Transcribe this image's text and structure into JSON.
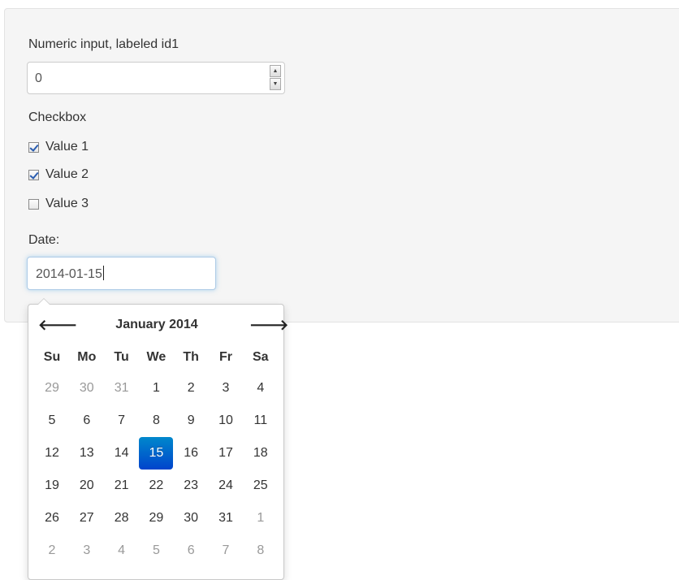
{
  "form": {
    "numeric_label": "Numeric input, labeled id1",
    "numeric_value": "0",
    "checkbox_label": "Checkbox",
    "checkboxes": [
      {
        "label": "Value 1",
        "checked": true
      },
      {
        "label": "Value 2",
        "checked": true
      },
      {
        "label": "Value 3",
        "checked": false
      }
    ],
    "date_label": "Date:",
    "date_value": "2014-01-15"
  },
  "datepicker": {
    "title": "January 2014",
    "prev_icon": "arrow-left-icon",
    "next_icon": "arrow-right-icon",
    "prev_glyph": "🡐",
    "next_glyph": "🡒",
    "weekdays": [
      "Su",
      "Mo",
      "Tu",
      "We",
      "Th",
      "Fr",
      "Sa"
    ],
    "weeks": [
      [
        {
          "d": "29",
          "old": true
        },
        {
          "d": "30",
          "old": true
        },
        {
          "d": "31",
          "old": true
        },
        {
          "d": "1"
        },
        {
          "d": "2"
        },
        {
          "d": "3"
        },
        {
          "d": "4"
        }
      ],
      [
        {
          "d": "5"
        },
        {
          "d": "6"
        },
        {
          "d": "7"
        },
        {
          "d": "8"
        },
        {
          "d": "9"
        },
        {
          "d": "10"
        },
        {
          "d": "11"
        }
      ],
      [
        {
          "d": "12"
        },
        {
          "d": "13"
        },
        {
          "d": "14"
        },
        {
          "d": "15",
          "active": true
        },
        {
          "d": "16"
        },
        {
          "d": "17"
        },
        {
          "d": "18"
        }
      ],
      [
        {
          "d": "19"
        },
        {
          "d": "20"
        },
        {
          "d": "21"
        },
        {
          "d": "22"
        },
        {
          "d": "23"
        },
        {
          "d": "24"
        },
        {
          "d": "25"
        }
      ],
      [
        {
          "d": "26"
        },
        {
          "d": "27"
        },
        {
          "d": "28"
        },
        {
          "d": "29"
        },
        {
          "d": "30"
        },
        {
          "d": "31"
        },
        {
          "d": "1",
          "old": true
        }
      ],
      [
        {
          "d": "2",
          "old": true
        },
        {
          "d": "3",
          "old": true
        },
        {
          "d": "4",
          "old": true
        },
        {
          "d": "5",
          "old": true
        },
        {
          "d": "6",
          "old": true
        },
        {
          "d": "7",
          "old": true
        },
        {
          "d": "8",
          "old": true
        }
      ]
    ],
    "active_color": "#0066cc",
    "muted_color": "#999999"
  }
}
